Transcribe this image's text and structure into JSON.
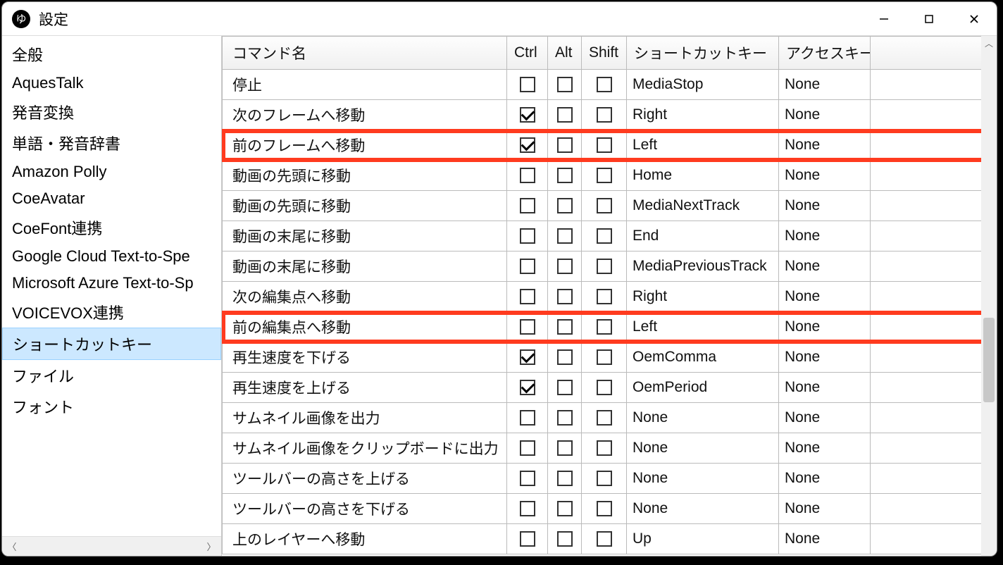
{
  "window": {
    "title": "設定",
    "app_icon_char": "ゆ"
  },
  "sidebar": {
    "items": [
      "全般",
      "AquesTalk",
      "発音変換",
      "単語・発音辞書",
      "Amazon Polly",
      "CoeAvatar",
      "CoeFont連携",
      "Google Cloud Text-to-Spe",
      "Microsoft Azure Text-to-Sp",
      "VOICEVOX連携",
      "ショートカットキー",
      "ファイル",
      "フォント"
    ],
    "selected_index": 10
  },
  "table": {
    "cols": {
      "command": "コマンド名",
      "ctrl": "Ctrl",
      "alt": "Alt",
      "shift": "Shift",
      "shortcut": "ショートカットキー",
      "access": "アクセスキー"
    },
    "rows": [
      {
        "command": "停止",
        "ctrl": false,
        "alt": false,
        "shift": false,
        "shortcut": "MediaStop",
        "access": "None",
        "highlight": false
      },
      {
        "command": "次のフレームへ移動",
        "ctrl": true,
        "alt": false,
        "shift": false,
        "shortcut": "Right",
        "access": "None",
        "highlight": false
      },
      {
        "command": "前のフレームへ移動",
        "ctrl": true,
        "alt": false,
        "shift": false,
        "shortcut": "Left",
        "access": "None",
        "highlight": true
      },
      {
        "command": "動画の先頭に移動",
        "ctrl": false,
        "alt": false,
        "shift": false,
        "shortcut": "Home",
        "access": "None",
        "highlight": false
      },
      {
        "command": "動画の先頭に移動",
        "ctrl": false,
        "alt": false,
        "shift": false,
        "shortcut": "MediaNextTrack",
        "access": "None",
        "highlight": false
      },
      {
        "command": "動画の末尾に移動",
        "ctrl": false,
        "alt": false,
        "shift": false,
        "shortcut": "End",
        "access": "None",
        "highlight": false
      },
      {
        "command": "動画の末尾に移動",
        "ctrl": false,
        "alt": false,
        "shift": false,
        "shortcut": "MediaPreviousTrack",
        "access": "None",
        "highlight": false
      },
      {
        "command": "次の編集点へ移動",
        "ctrl": false,
        "alt": false,
        "shift": false,
        "shortcut": "Right",
        "access": "None",
        "highlight": false
      },
      {
        "command": "前の編集点へ移動",
        "ctrl": false,
        "alt": false,
        "shift": false,
        "shortcut": "Left",
        "access": "None",
        "highlight": true
      },
      {
        "command": "再生速度を下げる",
        "ctrl": true,
        "alt": false,
        "shift": false,
        "shortcut": "OemComma",
        "access": "None",
        "highlight": false
      },
      {
        "command": "再生速度を上げる",
        "ctrl": true,
        "alt": false,
        "shift": false,
        "shortcut": "OemPeriod",
        "access": "None",
        "highlight": false
      },
      {
        "command": "サムネイル画像を出力",
        "ctrl": false,
        "alt": false,
        "shift": false,
        "shortcut": "None",
        "access": "None",
        "highlight": false
      },
      {
        "command": "サムネイル画像をクリップボードに出力",
        "ctrl": false,
        "alt": false,
        "shift": false,
        "shortcut": "None",
        "access": "None",
        "highlight": false
      },
      {
        "command": "ツールバーの高さを上げる",
        "ctrl": false,
        "alt": false,
        "shift": false,
        "shortcut": "None",
        "access": "None",
        "highlight": false
      },
      {
        "command": "ツールバーの高さを下げる",
        "ctrl": false,
        "alt": false,
        "shift": false,
        "shortcut": "None",
        "access": "None",
        "highlight": false
      },
      {
        "command": "上のレイヤーへ移動",
        "ctrl": false,
        "alt": false,
        "shift": false,
        "shortcut": "Up",
        "access": "None",
        "highlight": false
      }
    ]
  }
}
